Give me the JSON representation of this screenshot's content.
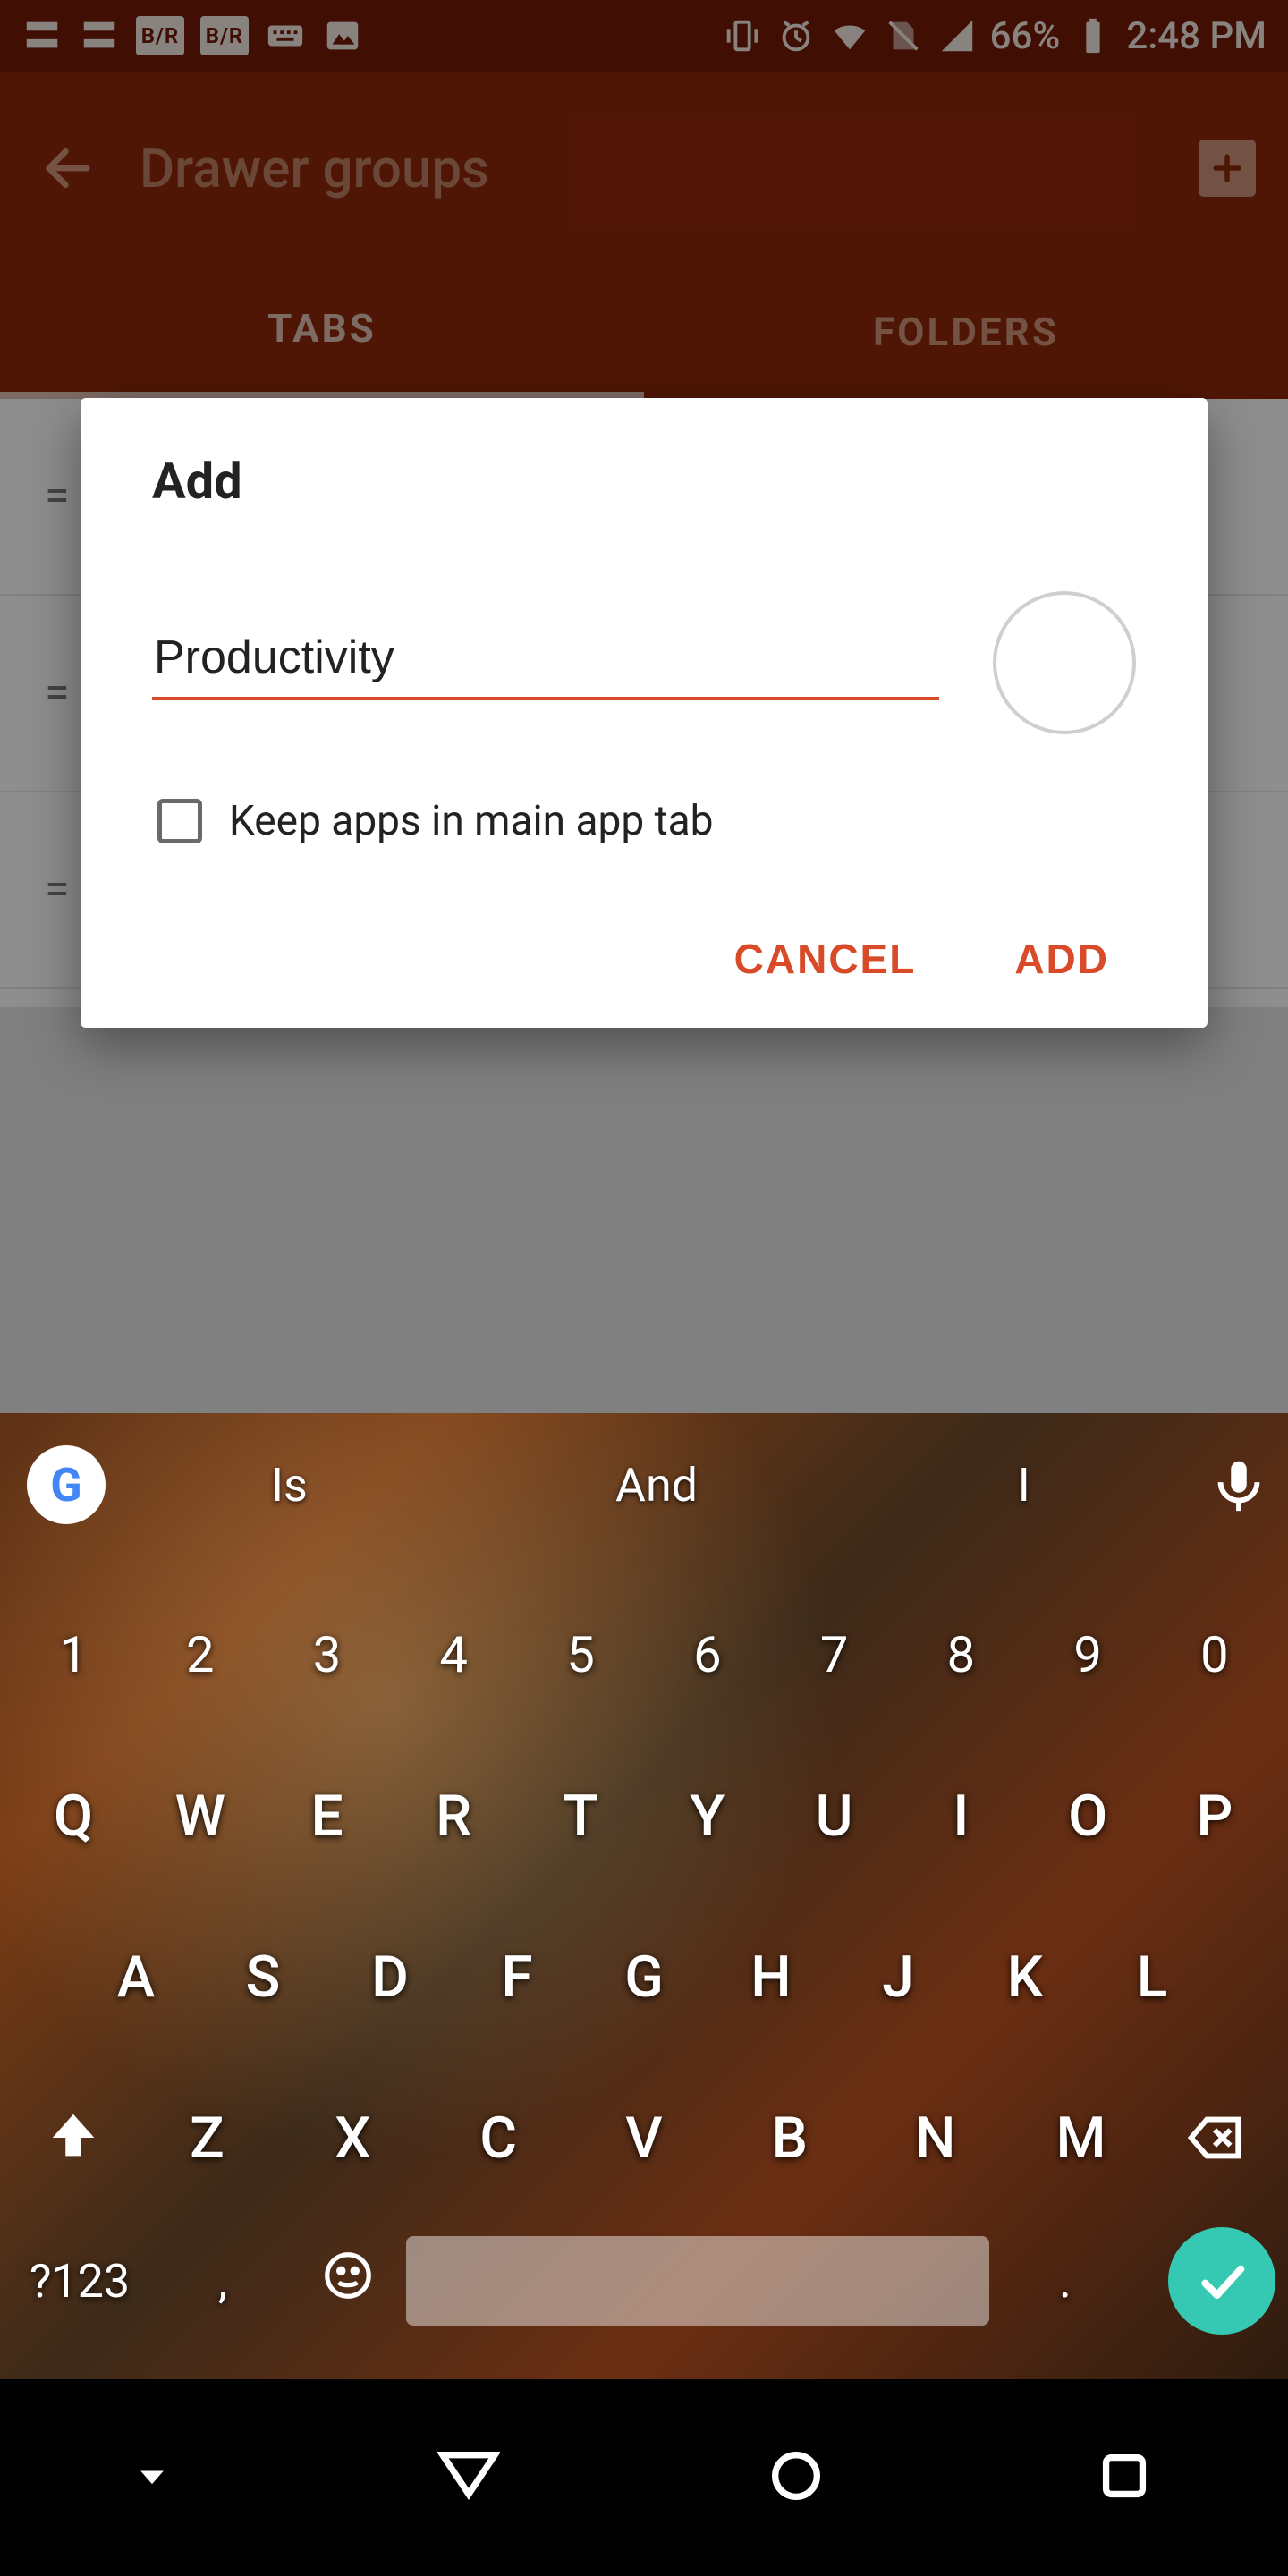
{
  "statusbar": {
    "battery_pct": "66%",
    "clock": "2:48 PM",
    "left_icons": [
      "notif-1",
      "notif-2",
      "br-1",
      "br-2",
      "keyboard-icon",
      "photos-icon"
    ],
    "right_icons": [
      "vibrate-icon",
      "alarm-icon",
      "wifi-icon",
      "no-sim-icon",
      "signal-icon"
    ]
  },
  "header": {
    "title": "Drawer groups"
  },
  "tabs": {
    "tab1": "TABS",
    "tab2": "FOLDERS"
  },
  "dialog": {
    "title": "Add",
    "input_value": "Productivity",
    "checkbox_label": "Keep apps in main app tab",
    "cancel": "CANCEL",
    "add": "ADD"
  },
  "keyboard": {
    "suggestions": [
      "Is",
      "And",
      "I"
    ],
    "row_num": [
      "1",
      "2",
      "3",
      "4",
      "5",
      "6",
      "7",
      "8",
      "9",
      "0"
    ],
    "row_q": [
      "Q",
      "W",
      "E",
      "R",
      "T",
      "Y",
      "U",
      "I",
      "O",
      "P"
    ],
    "row_a": [
      "A",
      "S",
      "D",
      "F",
      "G",
      "H",
      "J",
      "K",
      "L"
    ],
    "row_z": [
      "Z",
      "X",
      "C",
      "V",
      "B",
      "N",
      "M"
    ],
    "sym": "?123",
    "comma": ",",
    "period": "."
  }
}
